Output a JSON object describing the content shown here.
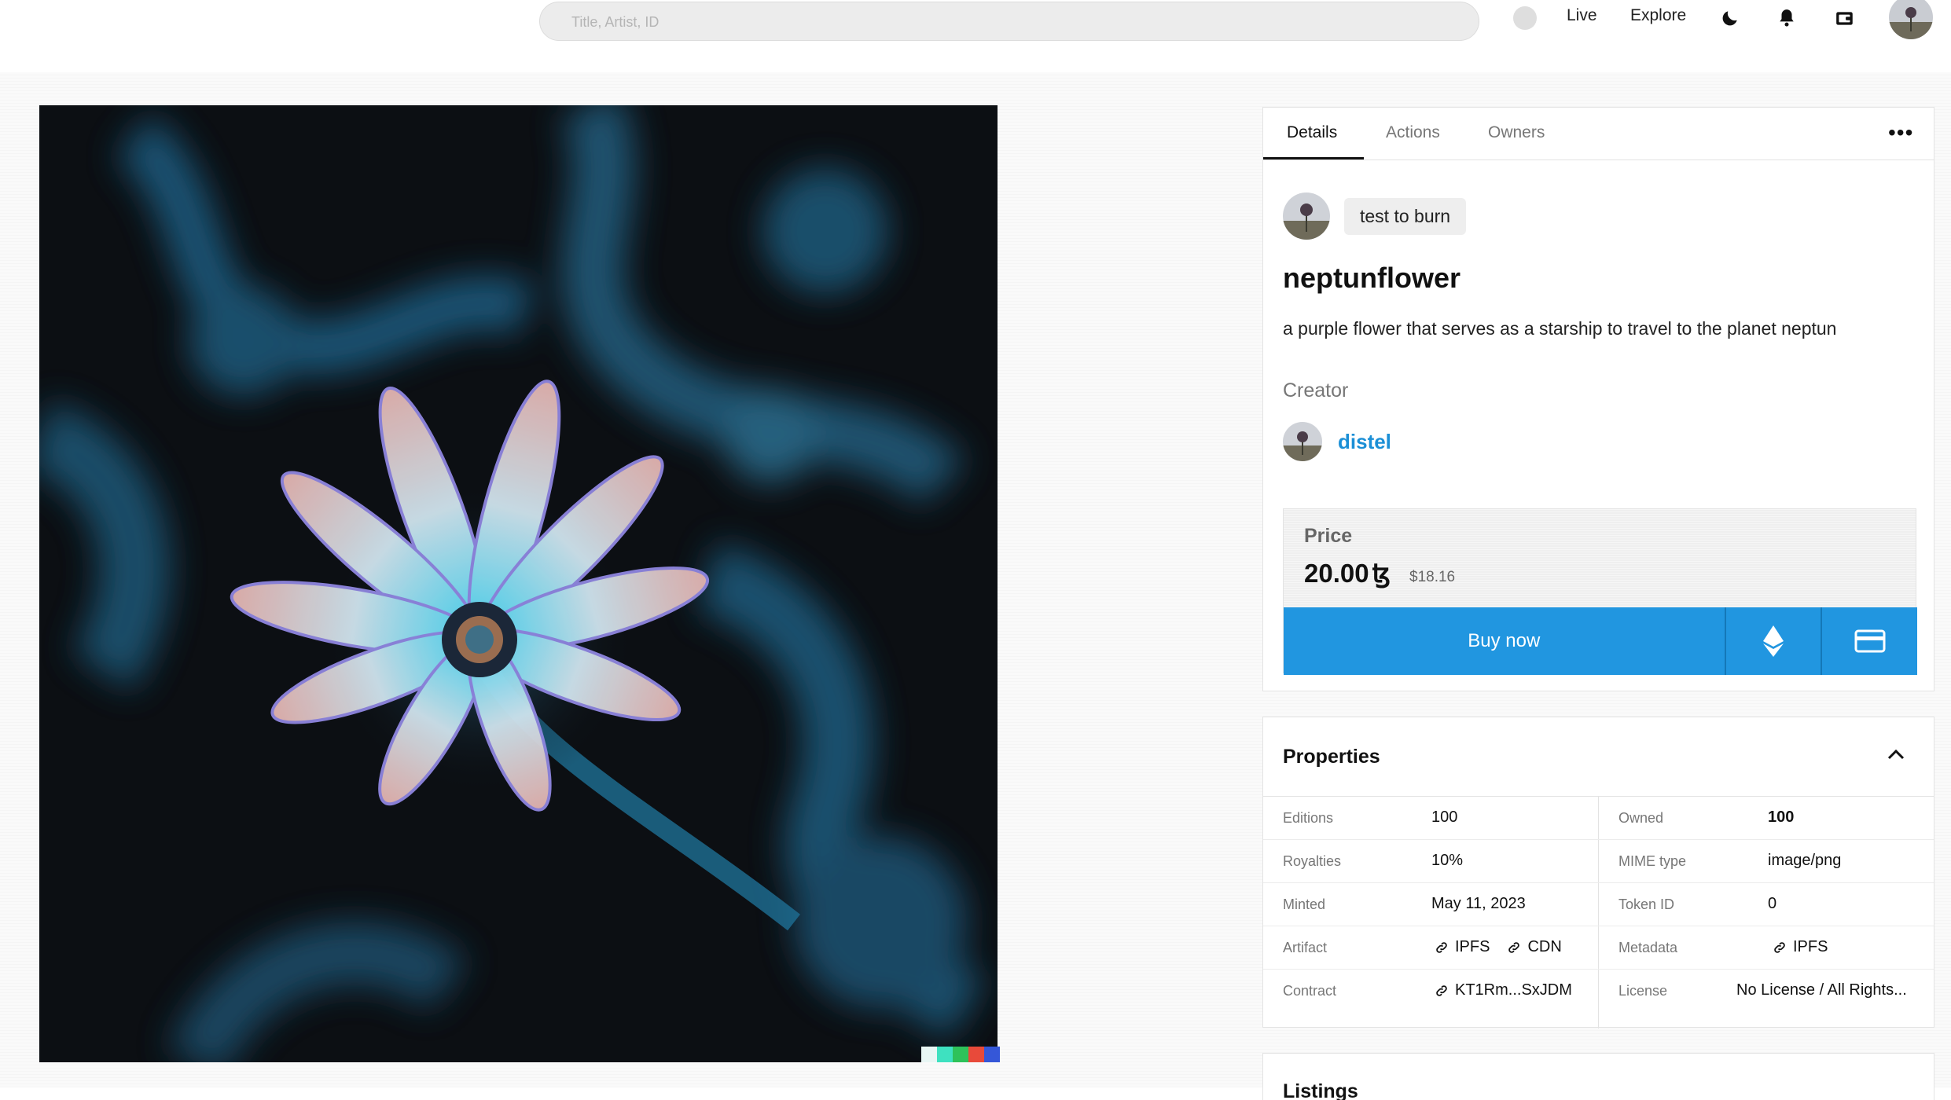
{
  "header": {
    "search_placeholder": "Title, Artist, ID",
    "nav": {
      "live": "Live",
      "explore": "Explore"
    },
    "icons": [
      "moon-icon",
      "bell-icon",
      "wallet-icon"
    ]
  },
  "artwork": {
    "swatch_colors": [
      "#e8f6f4",
      "#3ee1c0",
      "#2ec25a",
      "#e84a3a",
      "#3557d8"
    ]
  },
  "details": {
    "tabs": [
      "Details",
      "Actions",
      "Owners"
    ],
    "active_tab": "Details",
    "more_label": "•••",
    "owner_chip": "test to burn",
    "title": "neptunflower",
    "description": "a purple flower that serves as a starship to travel to the planet neptun",
    "creator_label": "Creator",
    "creator_name": "distel",
    "price": {
      "label": "Price",
      "value": "20.00",
      "currency_symbol": "ꜩ",
      "usd": "$18.16"
    },
    "buy_label": "Buy now",
    "accent_color": "#2196e0"
  },
  "properties": {
    "title": "Properties",
    "rows": [
      {
        "k1": "Editions",
        "v1": "100",
        "k2": "Owned",
        "v2": "100"
      },
      {
        "k1": "Royalties",
        "v1": "10%",
        "k2": "MIME type",
        "v2": "image/png"
      },
      {
        "k1": "Minted",
        "v1": "May 11, 2023",
        "k2": "Token ID",
        "v2": "0"
      },
      {
        "k1": "Artifact",
        "v1a": "IPFS",
        "v1b": "CDN",
        "k2": "Metadata",
        "v2": "IPFS"
      },
      {
        "k1": "Contract",
        "v1": "KT1Rm...SxJDM",
        "k2": "License",
        "v2": "No License / All Rights..."
      }
    ]
  },
  "listings": {
    "title": "Listings"
  }
}
